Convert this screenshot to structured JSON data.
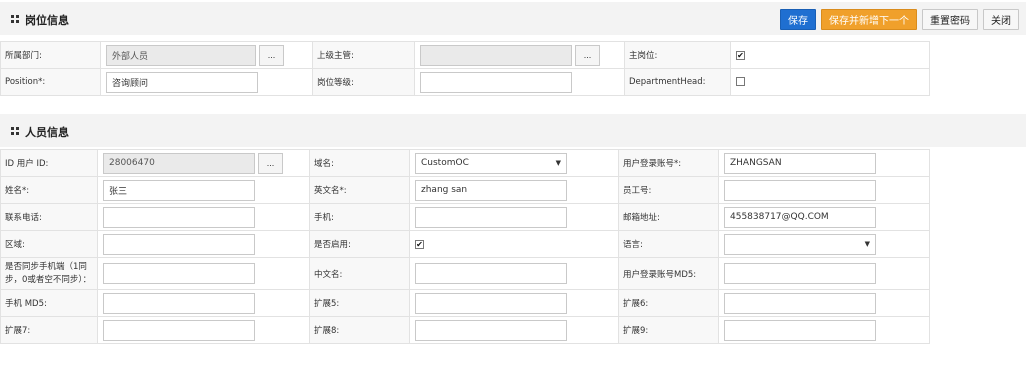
{
  "post_section": {
    "title": "岗位信息",
    "icon": "grid-icon",
    "buttons": {
      "save": "保存",
      "save_new": "保存并新增下一个",
      "reset_password": "重置密码",
      "close": "关闭"
    },
    "fields": {
      "department_label": "所属部门:",
      "department_value": "外部人员",
      "superior_label": "上级主管:",
      "superior_value": "",
      "main_post_label": "主岗位:",
      "main_post_checked": true,
      "position_label": "Position*:",
      "position_value": "咨询顾问",
      "post_level_label": "岗位等级:",
      "post_level_value": "",
      "department_head_label": "DepartmentHead:",
      "department_head_checked": false
    },
    "picker_label": "..."
  },
  "person_section": {
    "title": "人员信息",
    "icon": "grid-icon",
    "picker_label": "...",
    "fields": {
      "user_id_label": "ID 用户 ID:",
      "user_id_value": "28006470",
      "domain_label": "域名:",
      "domain_value": "CustomOC",
      "login_label": "用户登录账号*:",
      "login_value": "ZHANGSAN",
      "name_label": "姓名*:",
      "name_value": "张三",
      "english_name_label": "英文名*:",
      "english_name_value": "zhang san",
      "employee_no_label": "员工号:",
      "employee_no_value": "",
      "phone_label": "联系电话:",
      "phone_value": "",
      "mobile_label": "手机:",
      "mobile_value": "",
      "email_label": "邮箱地址:",
      "email_value": "455838717@QQ.COM",
      "region_label": "区域:",
      "region_value": "",
      "enabled_label": "是否启用:",
      "enabled_checked": true,
      "language_label": "语言:",
      "language_value": "",
      "sync_label_line1": "是否同步手机端（1同",
      "sync_label_line2": "步，0或者空不同步）：",
      "sync_value": "",
      "chinese_name_label": "中文名:",
      "chinese_name_value": "",
      "login_md5_label": "用户登录账号MD5:",
      "login_md5_value": "",
      "mobile_md5_label": "手机 MD5:",
      "mobile_md5_value": "",
      "ext5_label": "扩展5:",
      "ext5_value": "",
      "ext6_label": "扩展6:",
      "ext6_value": "",
      "ext7_label": "扩展7:",
      "ext7_value": "",
      "ext8_label": "扩展8:",
      "ext8_value": "",
      "ext9_label": "扩展9:",
      "ext9_value": ""
    }
  },
  "checkbox_glyph": "✔",
  "caret_glyph": "▼"
}
